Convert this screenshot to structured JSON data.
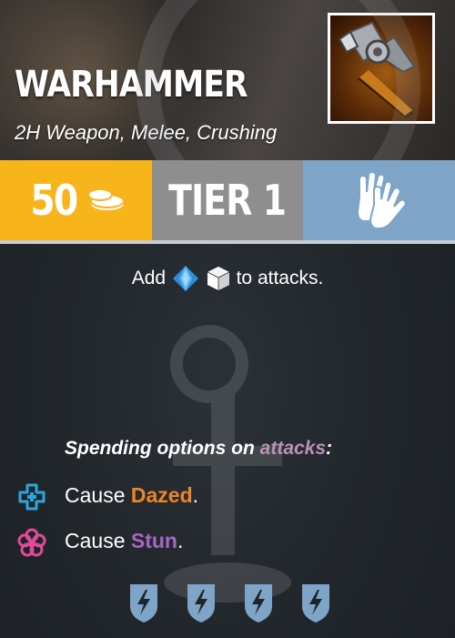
{
  "card": {
    "title": "WARHAMMER",
    "subtitle": "2H Weapon, Melee, Crushing"
  },
  "stats": {
    "cost": "50",
    "cost_icon": "coins-icon",
    "tier": "TIER 1",
    "hands_icon": "two-hands-icon"
  },
  "effect": {
    "add_prefix": "Add",
    "add_suffix": "to attacks.",
    "dice": [
      "blue-die-icon",
      "white-die-icon"
    ]
  },
  "spending": {
    "title_prefix": "Spending options on",
    "title_keyword": "attacks",
    "title_suffix": ":",
    "options": [
      {
        "icon": "blue-cross-icon",
        "prefix": "Cause",
        "keyword": "Dazed",
        "suffix": "."
      },
      {
        "icon": "pink-flower-icon",
        "prefix": "Cause",
        "keyword": "Stun",
        "suffix": "."
      }
    ]
  },
  "colors": {
    "cost_bg": "#f7b51b",
    "tier_bg": "#8e8e8e",
    "hands_bg": "#7ea5c8",
    "dazed": "#ee8526",
    "stun": "#a766c4",
    "attacks_keyword": "#b992b8",
    "shield": "#7ea5c8"
  },
  "footer": {
    "shield_icons": [
      "shield-lightning-icon",
      "shield-lightning-icon",
      "shield-lightning-icon",
      "shield-lightning-icon"
    ]
  }
}
